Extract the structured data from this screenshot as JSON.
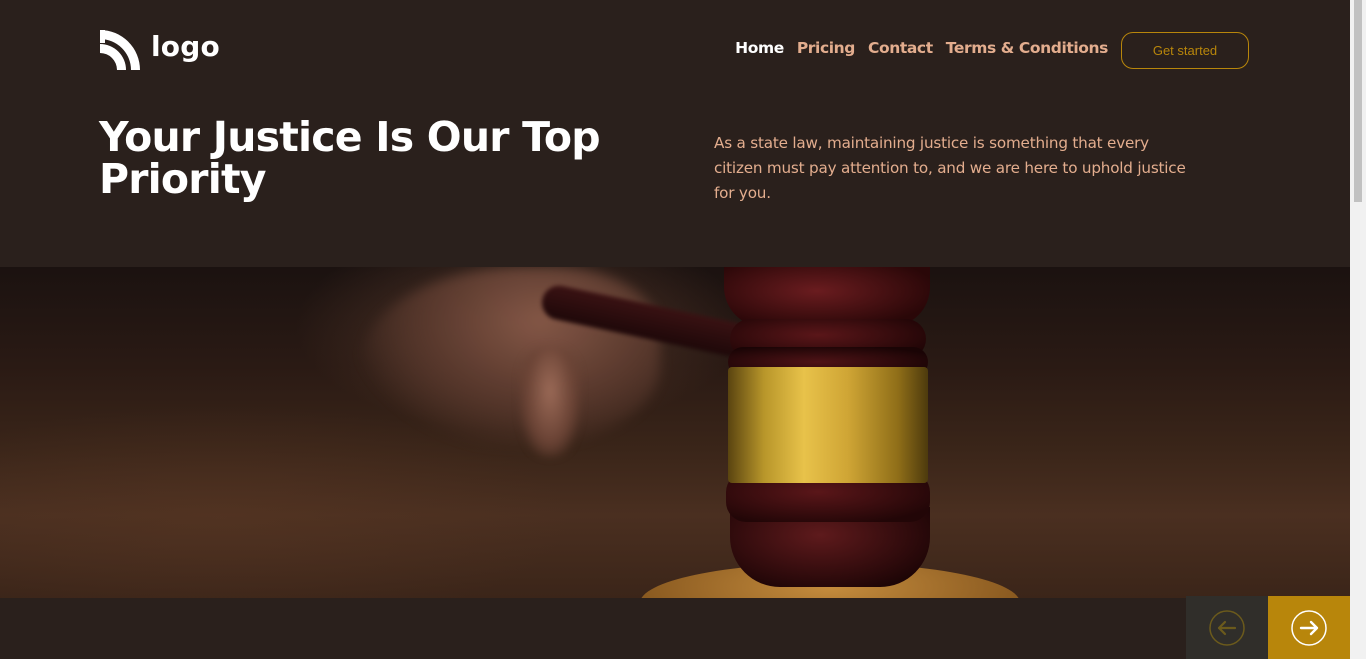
{
  "header": {
    "logo_text": "logo",
    "logo_icon": "rss-arcs-icon",
    "nav": [
      {
        "label": "Home",
        "active": true
      },
      {
        "label": "Pricing",
        "active": false
      },
      {
        "label": "Contact",
        "active": false
      },
      {
        "label": "Terms & Conditions",
        "active": false
      }
    ],
    "cta_label": "Get started"
  },
  "hero": {
    "title": "Your Justice Is Our Top Priority",
    "description": "As a state law, maintaining justice is something that every citizen must pay attention to, and we are here to uphold justice for you."
  },
  "slider": {
    "prev_icon": "arrow-left-icon",
    "next_icon": "arrow-right-icon"
  },
  "colors": {
    "background": "#2a201c",
    "accent": "#b8860b",
    "nav_text": "#e3ad8e",
    "active_nav_text": "#ffffff",
    "slider_prev_bg": "#302e2a"
  }
}
